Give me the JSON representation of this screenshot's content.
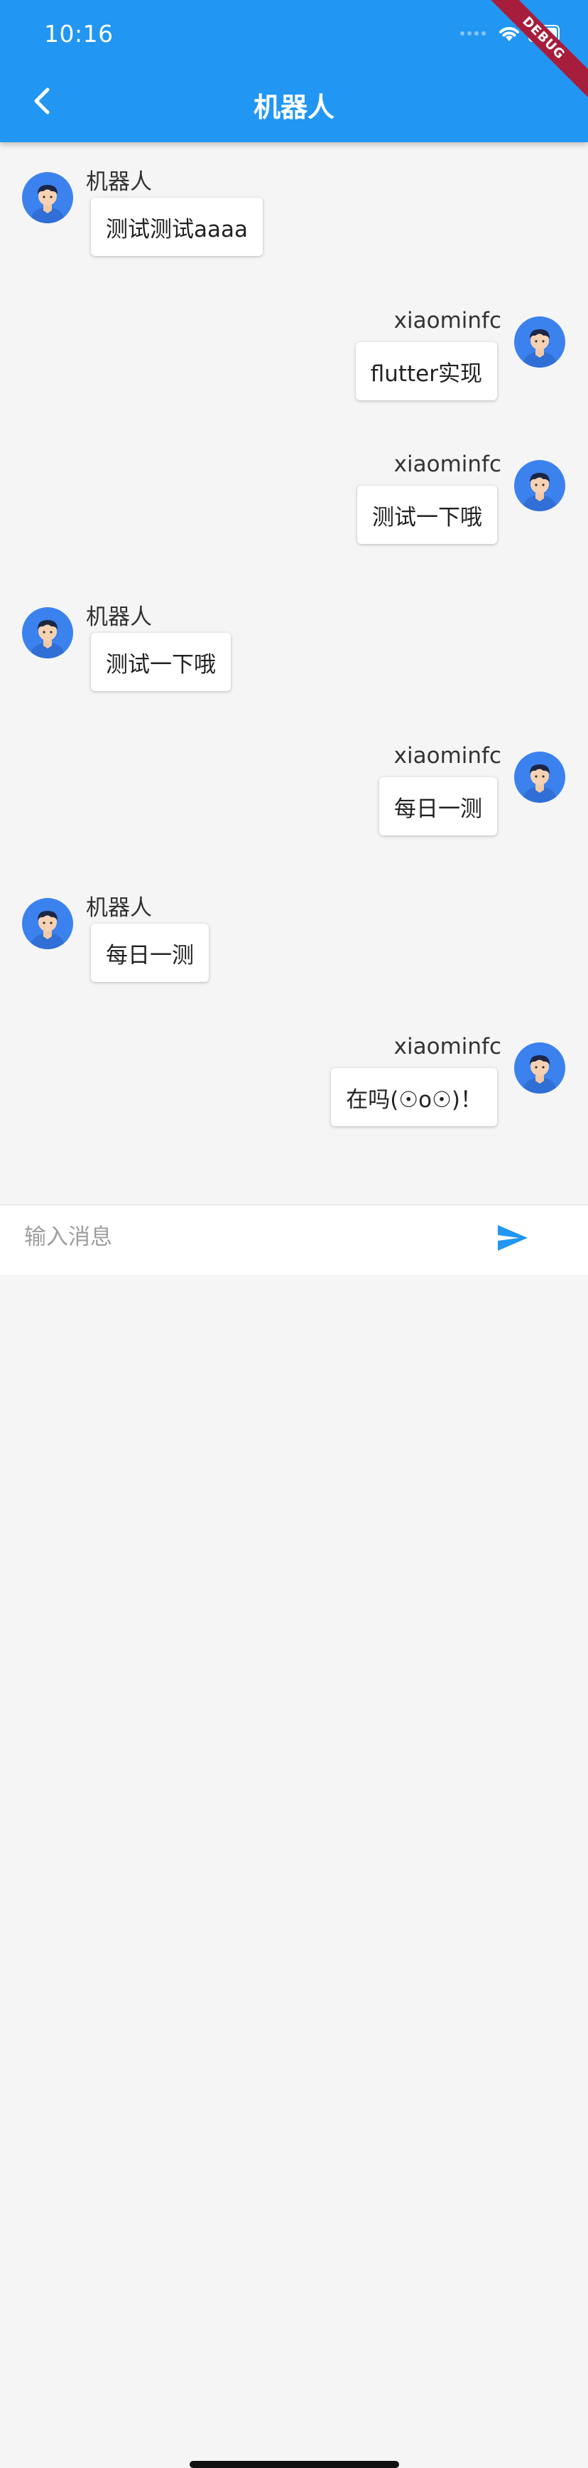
{
  "status_bar": {
    "time": "10:16"
  },
  "debug_banner": "DEBUG",
  "header": {
    "title": "机器人"
  },
  "messages": [
    {
      "side": "left",
      "name": "机器人",
      "text": "测试测试aaaa"
    },
    {
      "side": "right",
      "name": "xiaominfc",
      "text": "flutter实现"
    },
    {
      "side": "right",
      "name": "xiaominfc",
      "text": "测试一下哦"
    },
    {
      "side": "left",
      "name": "机器人",
      "text": "测试一下哦"
    },
    {
      "side": "right",
      "name": "xiaominfc",
      "text": "每日一测"
    },
    {
      "side": "left",
      "name": "机器人",
      "text": "每日一测"
    },
    {
      "side": "right",
      "name": "xiaominfc",
      "text": "在吗(☉o☉)！"
    }
  ],
  "input": {
    "placeholder": "输入消息",
    "value": ""
  },
  "colors": {
    "primary": "#2196F3",
    "avatar": "#3b82ee",
    "send": "#2196F3"
  },
  "icons": [
    "back-arrow-icon",
    "wifi-icon",
    "battery-icon",
    "signal-icon",
    "avatar-icon",
    "send-icon"
  ]
}
